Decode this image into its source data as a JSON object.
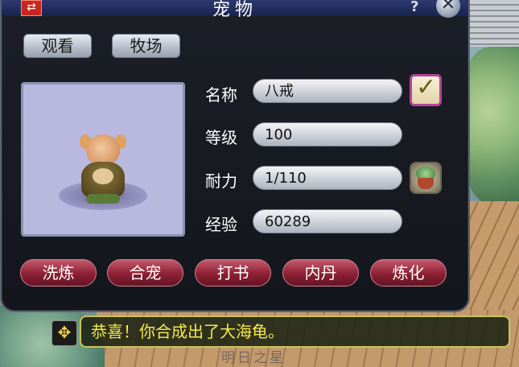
{
  "window": {
    "title": "宠物",
    "close_label": "✕",
    "help_label": "?"
  },
  "tabs": [
    {
      "label": "观看"
    },
    {
      "label": "牧场"
    }
  ],
  "pet": {
    "fields": [
      {
        "label": "名称",
        "value": "八戒"
      },
      {
        "label": "等级",
        "value": "100"
      },
      {
        "label": "耐力",
        "value": "1/110"
      },
      {
        "label": "经验",
        "value": "60289"
      }
    ],
    "checkbox_checked": true
  },
  "actions": [
    {
      "label": "洗炼"
    },
    {
      "label": "合宠"
    },
    {
      "label": "打书"
    },
    {
      "label": "内丹"
    },
    {
      "label": "炼化"
    }
  ],
  "notification": {
    "text": "恭喜！你合成出了大海龟。"
  },
  "background_text": "明日之星",
  "colors": {
    "action_button": "#8c1f33",
    "notice_text": "#f2ea48",
    "portrait_bg": "#b9b8df"
  }
}
